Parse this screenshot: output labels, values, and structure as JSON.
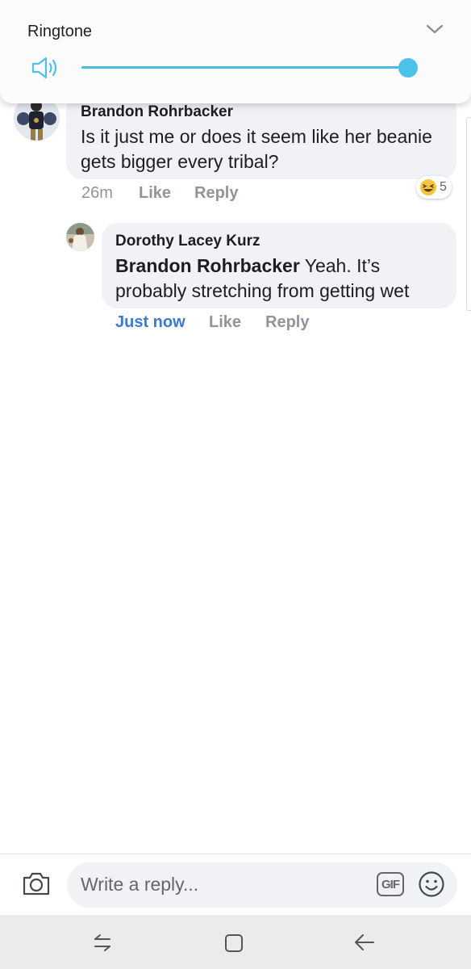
{
  "volume_panel": {
    "title": "Ringtone",
    "level_percent": 100,
    "icons": {
      "speaker": "speaker-icon",
      "collapse": "chevron-down-icon"
    },
    "accent_color": "#4cc2ea"
  },
  "comments": [
    {
      "author": "Brandon Rohrbacker",
      "text": "Is it just me or does it seem like her beanie gets bigger every tribal?",
      "time": "26m",
      "like_label": "Like",
      "reply_label": "Reply",
      "reaction": {
        "icon": "laughing-emoji-icon",
        "count": "5"
      }
    },
    {
      "author": "Dorothy Lacey Kurz",
      "mention": "Brandon Rohrbacker",
      "text": " Yeah. It’s probably stretching from getting wet",
      "time": "Just now",
      "like_label": "Like",
      "reply_label": "Reply"
    }
  ],
  "reply_bar": {
    "placeholder": "Write a reply...",
    "gif_label": "GIF",
    "icons": {
      "camera": "camera-icon",
      "emoji": "emoji-icon"
    }
  },
  "nav_bar": {
    "icons": [
      "recent-apps-icon",
      "home-icon",
      "back-icon"
    ]
  }
}
